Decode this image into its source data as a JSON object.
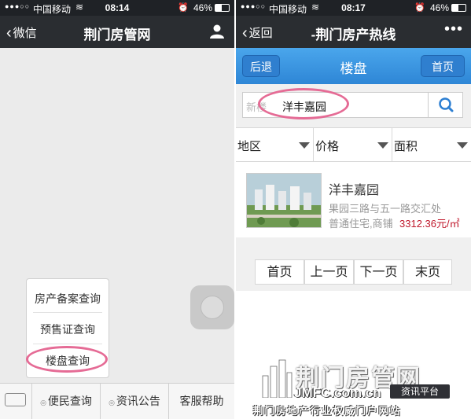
{
  "left_screen": {
    "status": {
      "signal": "●●●○○",
      "carrier": "中国移动",
      "time": "08:14",
      "battery": "46%"
    },
    "nav": {
      "back_label": "微信",
      "title": "荆门房管网"
    },
    "popup_menu": {
      "items": [
        "房产备案查询",
        "预售证查询",
        "楼盘查询"
      ],
      "highlighted": "楼盘查询"
    },
    "bottom_menu": {
      "tabs": [
        "便民查询",
        "资讯公告",
        "客服帮助"
      ]
    }
  },
  "right_screen": {
    "status": {
      "signal": "●●●○○",
      "carrier": "中国移动",
      "time": "08:17",
      "battery": "46%"
    },
    "nav": {
      "back_label": "返回",
      "title": "-荆门房产热线",
      "more": "•••"
    },
    "header": {
      "back_button": "后退",
      "title": "楼盘",
      "home_button": "首页"
    },
    "search": {
      "placeholder": "新楼",
      "value": "洋丰嘉园"
    },
    "filters": [
      "地区",
      "价格",
      "面积"
    ],
    "listing": {
      "name": "洋丰嘉园",
      "address": "果园三路与五一路交汇处",
      "type": "普通住宅,商铺",
      "price": "3312.36元/㎡"
    },
    "pager": [
      "首页",
      "上一页",
      "下一页",
      "末页"
    ],
    "watermark": {
      "name": "荆门房管网",
      "url": "JMFC.com.cn",
      "tag": "资讯平台",
      "slogan": "荆门房地产行业权威门户网站"
    }
  },
  "colors": {
    "nav_dark": "#2a2d31",
    "header_blue": "#3a97e3",
    "highlight_pink": "#e56b95",
    "price_red": "#c0192c"
  }
}
